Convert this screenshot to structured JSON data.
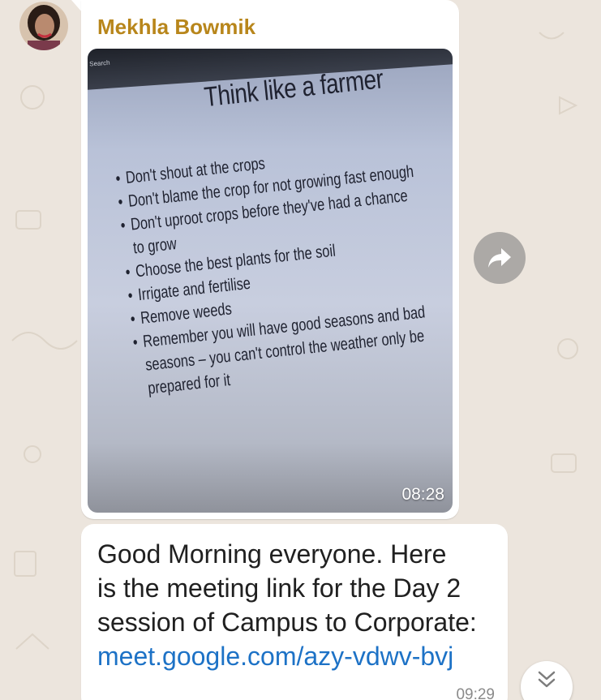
{
  "sender": {
    "name": "Mekhla Bowmik"
  },
  "image_message": {
    "photo": {
      "search_label": "Q Search",
      "slide_title": "Think like a farmer",
      "bullets": [
        "Don't shout at the crops",
        "Don't blame the crop for not growing fast enough",
        "Don't uproot crops before they've had a chance",
        "to grow",
        "Choose the best plants for the soil",
        "Irrigate and fertilise",
        "Remove weeds",
        "Remember you will have good seasons and bad",
        "seasons – you can't control the weather only be",
        "prepared for it"
      ]
    },
    "time": "08:28"
  },
  "text_message": {
    "line1": "Good Morning everyone. Here",
    "line2": "is the meeting link for the Day 2",
    "line3": "session of Campus to Corporate:",
    "link": "meet.google.com/azy-vdwv-bvj",
    "time": "09:29"
  },
  "icons": {
    "forward": "forward-arrow-icon",
    "scroll_down": "double-chevron-down-icon"
  },
  "colors": {
    "background": "#ece5dd",
    "sender_name": "#b8861b",
    "link": "#1d72c6",
    "bubble": "#ffffff"
  }
}
